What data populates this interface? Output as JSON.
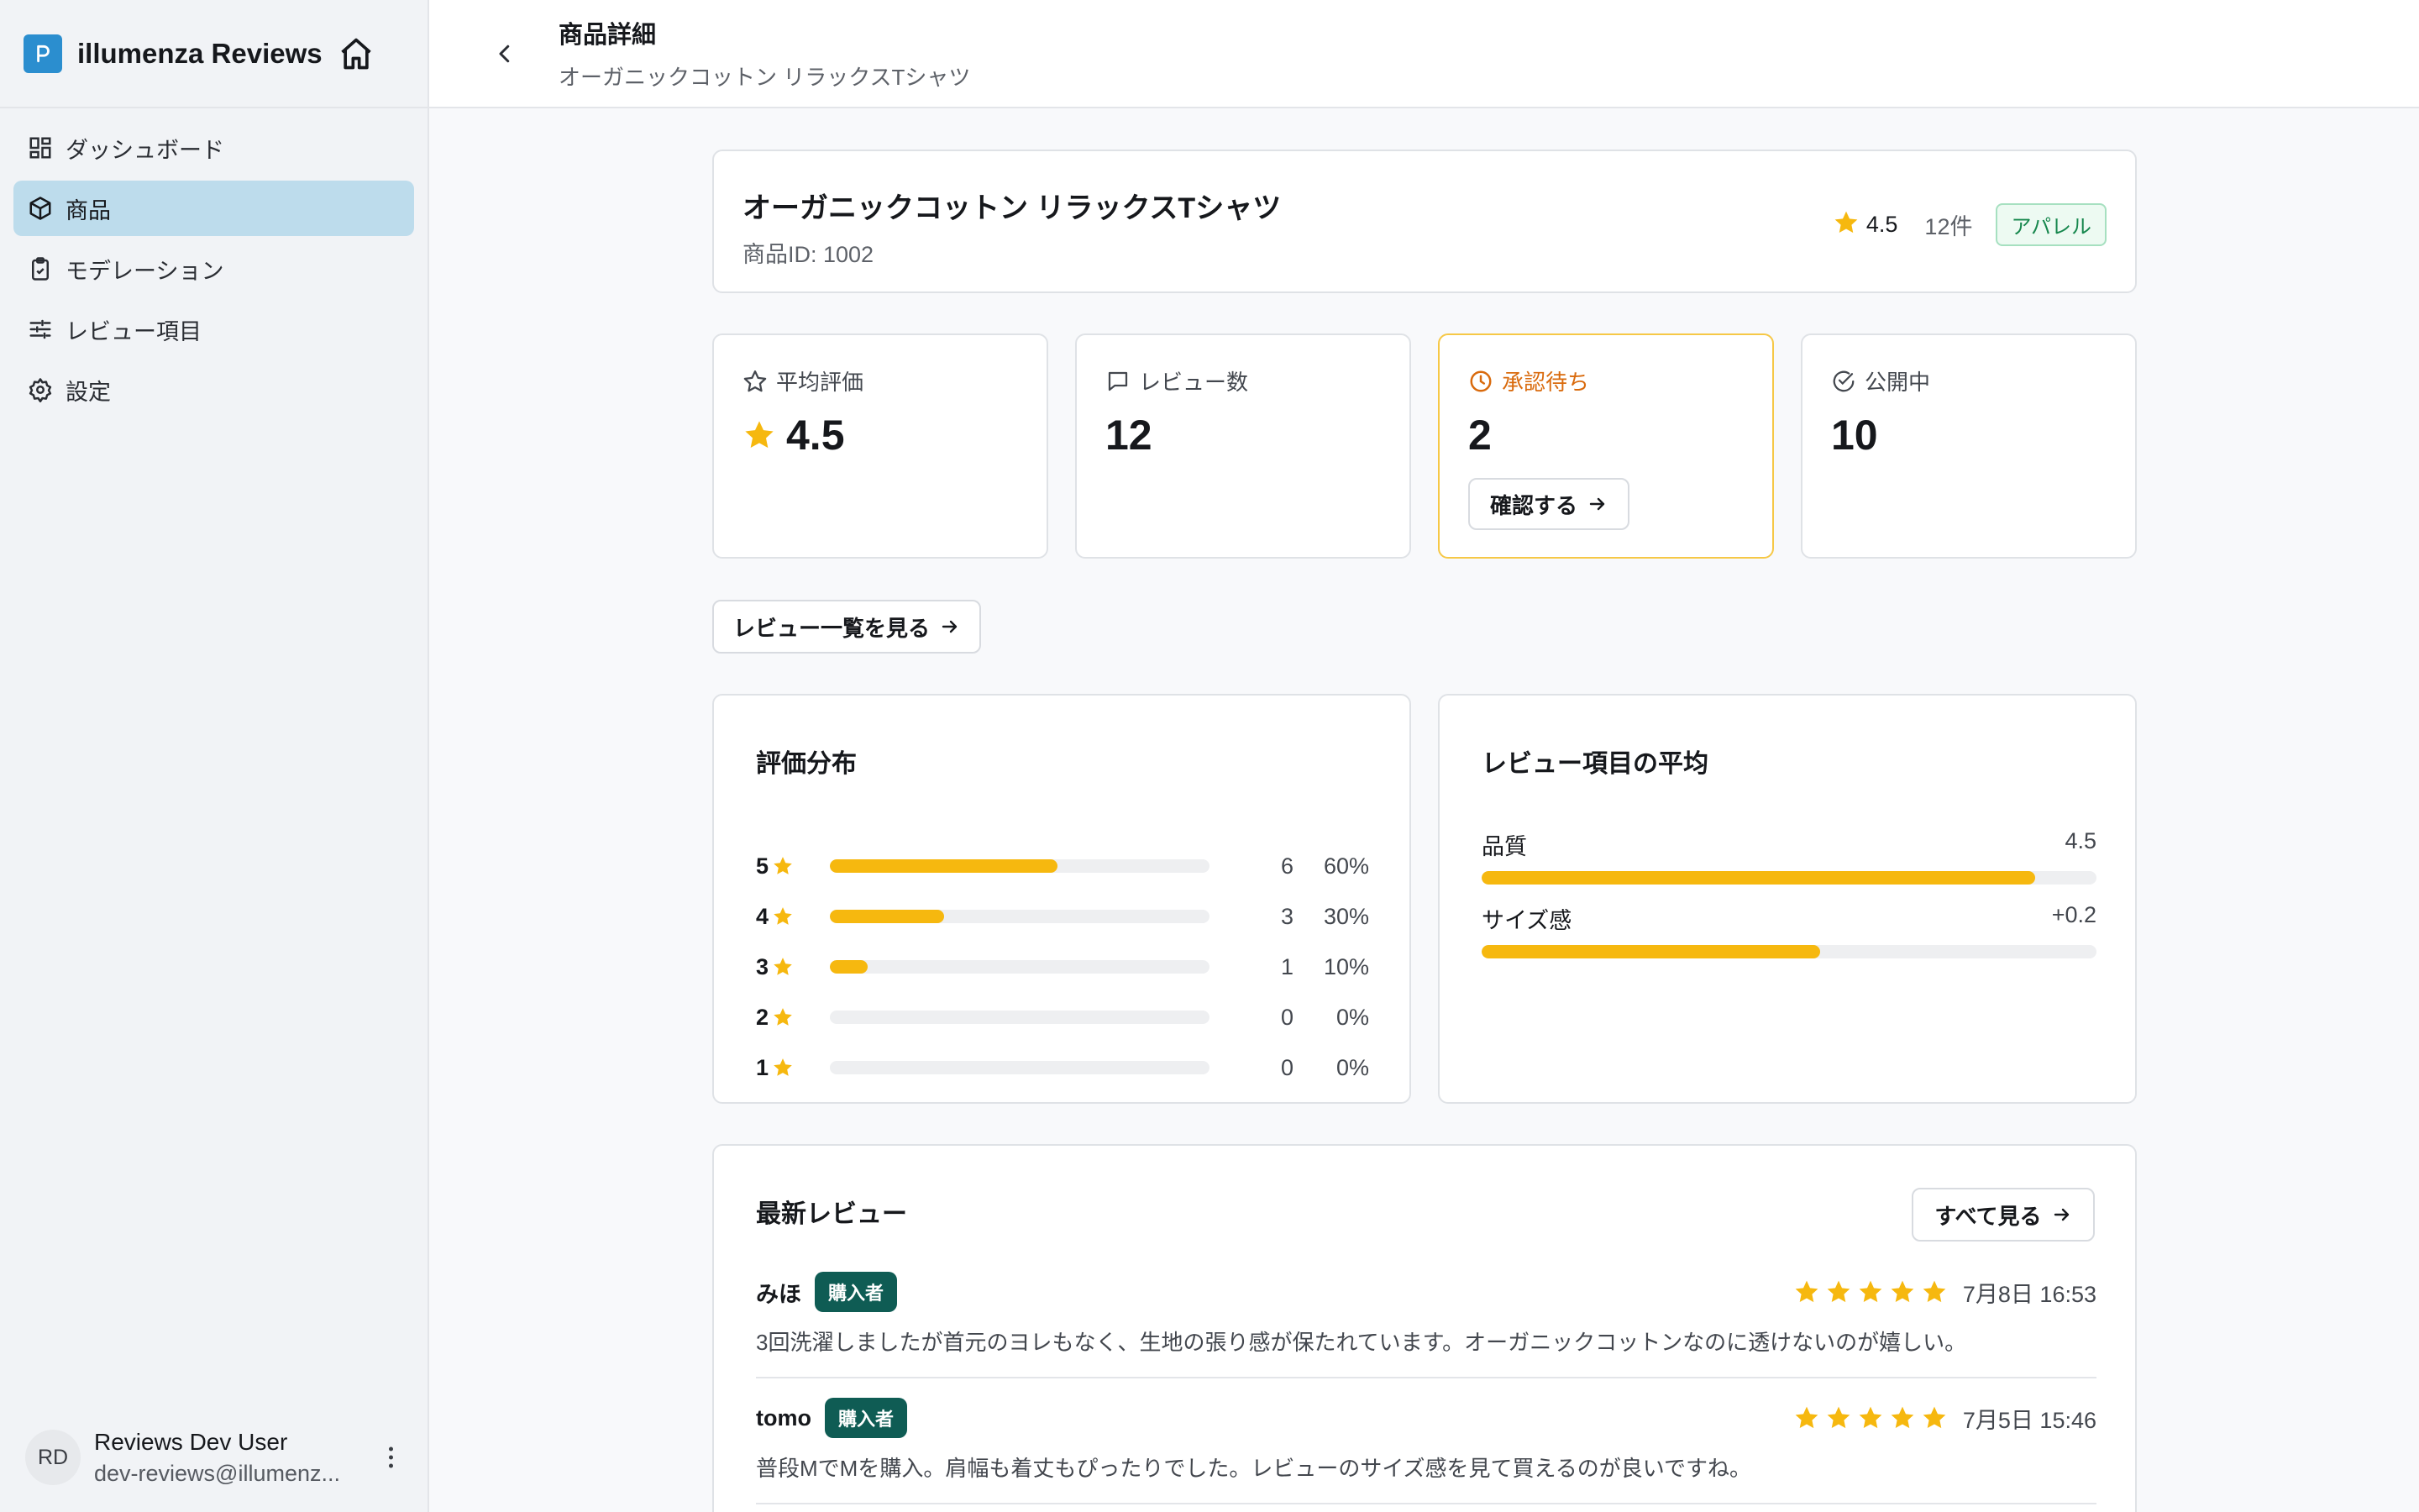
{
  "app": {
    "name": "illumenza Reviews"
  },
  "sidebar": {
    "items": [
      {
        "label": "ダッシュボード",
        "icon": "dashboard-icon",
        "active": false
      },
      {
        "label": "商品",
        "icon": "box-icon",
        "active": true
      },
      {
        "label": "モデレーション",
        "icon": "clipboard-check-icon",
        "active": false
      },
      {
        "label": "レビュー項目",
        "icon": "sliders-icon",
        "active": false
      },
      {
        "label": "設定",
        "icon": "gear-icon",
        "active": false
      }
    ],
    "user": {
      "initials": "RD",
      "name": "Reviews Dev User",
      "email": "dev-reviews@illumenz..."
    }
  },
  "header": {
    "title": "商品詳細",
    "subtitle": "オーガニックコットン リラックスTシャツ"
  },
  "product": {
    "name": "オーガニックコットン リラックスTシャツ",
    "id_label": "商品ID: 1002",
    "rating": "4.5",
    "count": "12件",
    "category": "アパレル"
  },
  "stats": {
    "average": {
      "label": "平均評価",
      "value": "4.5"
    },
    "reviews": {
      "label": "レビュー数",
      "value": "12"
    },
    "pending": {
      "label": "承認待ち",
      "value": "2",
      "button": "確認する"
    },
    "published": {
      "label": "公開中",
      "value": "10"
    }
  },
  "review_list_button": "レビュー一覧を見る",
  "distribution": {
    "title": "評価分布",
    "rows": [
      {
        "star": "5",
        "count": "6",
        "percent": "60%",
        "fraction": 0.6
      },
      {
        "star": "4",
        "count": "3",
        "percent": "30%",
        "fraction": 0.3
      },
      {
        "star": "3",
        "count": "1",
        "percent": "10%",
        "fraction": 0.1
      },
      {
        "star": "2",
        "count": "0",
        "percent": "0%",
        "fraction": 0
      },
      {
        "star": "1",
        "count": "0",
        "percent": "0%",
        "fraction": 0
      }
    ]
  },
  "attributes": {
    "title": "レビュー項目の平均",
    "items": [
      {
        "name": "品質",
        "value": "4.5",
        "fraction": 0.9
      },
      {
        "name": "サイズ感",
        "value": "+0.2",
        "fraction": 0.55
      }
    ]
  },
  "latest_reviews": {
    "title": "最新レビュー",
    "see_all": "すべて見る",
    "items": [
      {
        "author": "みほ",
        "badge": "購入者",
        "stars": 5,
        "date": "7月8日 16:53",
        "body": "3回洗濯しましたが首元のヨレもなく、生地の張り感が保たれています。オーガニックコットンなのに透けないのが嬉しい。"
      },
      {
        "author": "tomo",
        "badge": "購入者",
        "stars": 5,
        "date": "7月5日 15:46",
        "body": "普段MでMを購入。肩幅も着丈もぴったりでした。レビューのサイズ感を見て買えるのが良いですね。"
      }
    ]
  },
  "colors": {
    "accent": "#2b8ecf",
    "star": "#f6b80f",
    "active_nav": "#bddcec",
    "buyer_badge": "#0f5c54",
    "pending": "#d96a0c"
  }
}
